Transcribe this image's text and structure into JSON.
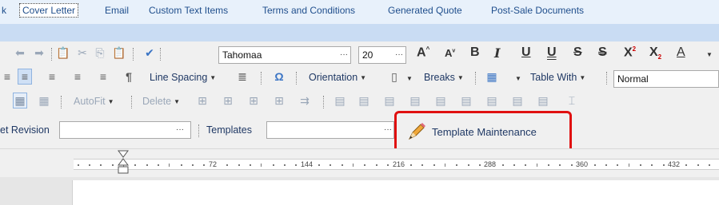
{
  "tabs": [
    "k",
    "Cover Letter",
    "Email",
    "Custom Text Items",
    "Terms and Conditions",
    "Generated Quote",
    "Post-Sale Documents"
  ],
  "active_tab": "Cover Letter",
  "row1": {
    "font_name": "Tahomaa",
    "font_size": "20",
    "ellipsis": "···"
  },
  "row2": {
    "line_spacing": "Line Spacing",
    "orientation": "Orientation",
    "breaks": "Breaks",
    "table_width": "Table With",
    "style_value": "Normal"
  },
  "row3": {
    "autofit": "AutoFit",
    "delete": "Delete"
  },
  "row4": {
    "revision_label": "et Revision",
    "revision_value": "",
    "templates_label": "Templates",
    "templates_value": "",
    "template_maintenance": "Template Maintenance"
  },
  "ruler": {
    "labels": [
      "72",
      "144",
      "216",
      "288",
      "360",
      "432"
    ]
  },
  "colors": {
    "highlight": "#e01010",
    "tab_text": "#1f4e8c",
    "band": "#c9dcf3"
  }
}
